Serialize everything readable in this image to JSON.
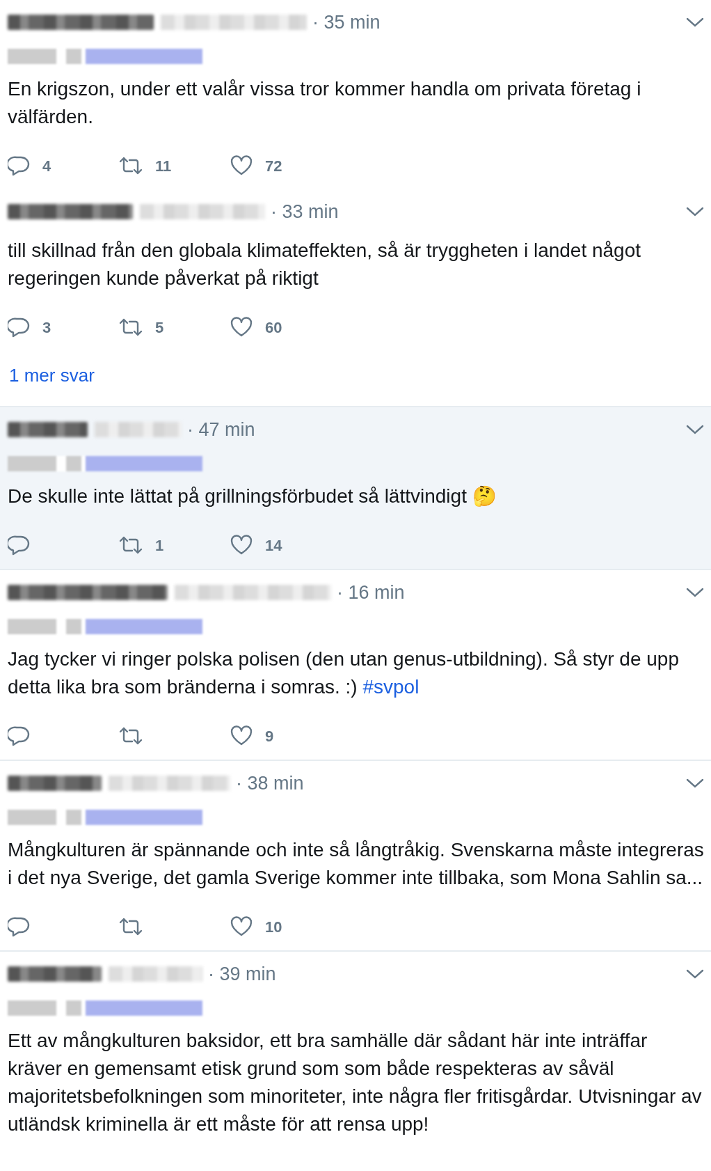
{
  "tweets": [
    {
      "name_redacted": true,
      "time": "· 35 min",
      "reply_to_redacted": true,
      "highlighted": false,
      "text": "En krigszon, under ett valår vissa tror kommer handla om privata företag i välfärden.",
      "actions": {
        "replies": "4",
        "retweets": "11",
        "likes": "72"
      }
    },
    {
      "name_redacted": true,
      "time": "· 33 min",
      "reply_to_redacted": false,
      "highlighted": false,
      "text": "till skillnad från den globala klimateffekten, så är tryggheten i landet något regeringen kunde påverkat på riktigt",
      "actions": {
        "replies": "3",
        "retweets": "5",
        "likes": "60"
      },
      "more_link": "1 mer svar"
    },
    {
      "name_redacted": true,
      "time": "· 47 min",
      "reply_to_redacted": true,
      "highlighted": true,
      "text": "De skulle inte lättat på grillningsförbudet så lättvindigt 🤔",
      "actions": {
        "retweets": "1",
        "likes": "14"
      }
    },
    {
      "name_redacted": true,
      "time": "· 16 min",
      "reply_to_redacted": true,
      "highlighted": false,
      "text": "Jag tycker vi ringer polska polisen (den utan genus-utbildning). Så styr de upp detta lika bra som bränderna i somras. :)",
      "hashtag": "#svpol",
      "actions": {
        "likes": "9"
      }
    },
    {
      "name_redacted": true,
      "time": "· 38 min",
      "reply_to_redacted": true,
      "highlighted": false,
      "text": "Mångkulturen är spännande och inte så långtråkig. Svenskarna måste integreras i det nya Sverige, det gamla Sverige kommer inte tillbaka, som Mona Sahlin sa...",
      "actions": {
        "likes": "10"
      }
    },
    {
      "name_redacted": true,
      "time": "· 39 min",
      "reply_to_redacted": true,
      "highlighted": false,
      "text": "Ett av mångkulturen baksidor, ett bra samhälle där sådant här inte inträffar kräver en gemensamt etisk grund som som både respekteras av såväl majoritetsbefolkningen som minoriteter, inte några fler fritisgårdar. Utvisningar av utländsk kriminella är ett måste för att rensa upp!"
    }
  ]
}
